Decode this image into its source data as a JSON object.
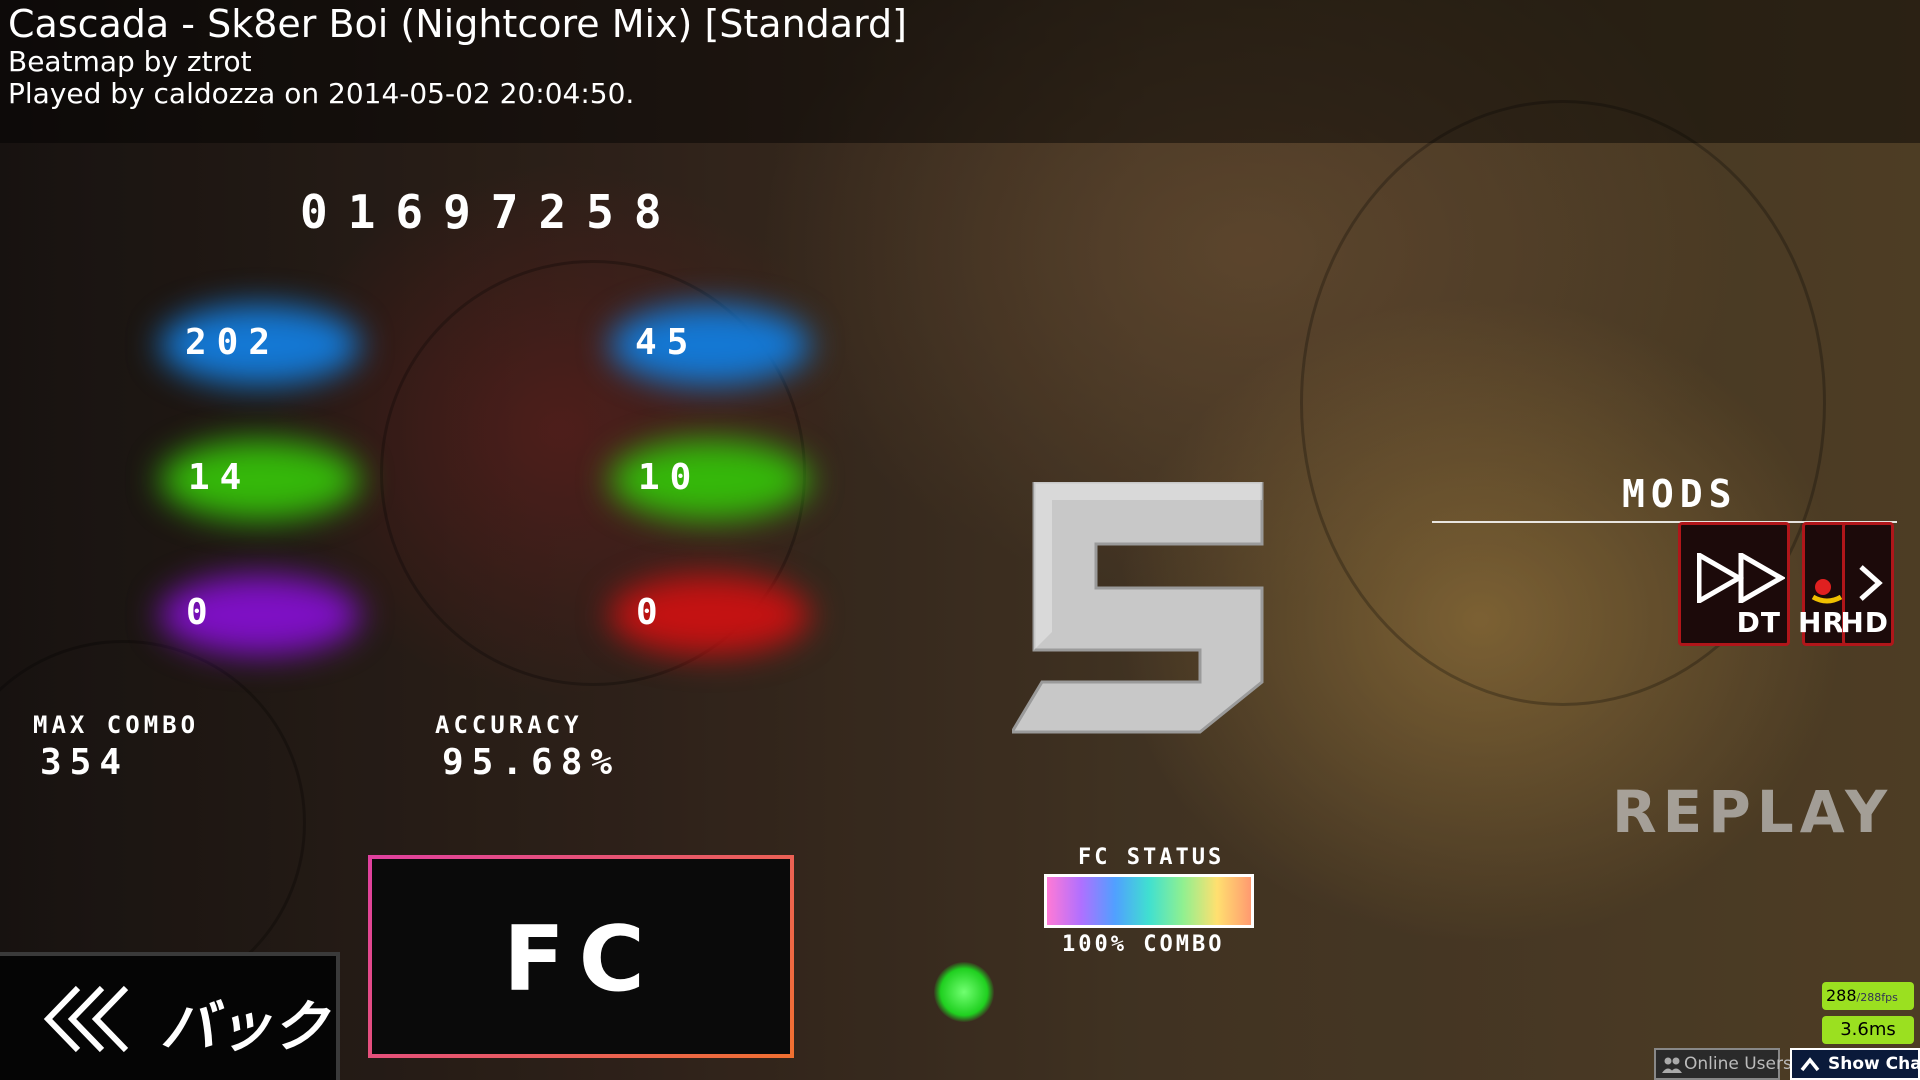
{
  "header": {
    "title": "Cascada - Sk8er Boi (Nightcore Mix) [Standard]",
    "beatmap_by": "Beatmap by ztrot",
    "played_by": "Played by caldozza on 2014-05-02 20:04:50."
  },
  "score": "01697258",
  "hits": {
    "count_300": "202",
    "count_geki": "45",
    "count_100": "14",
    "count_katu": "10",
    "count_50": "0",
    "count_miss": "0"
  },
  "stats": {
    "max_combo_label": "MAX COMBO",
    "max_combo": "354",
    "accuracy_label": "ACCURACY",
    "accuracy": "95.68%"
  },
  "grade": "S",
  "mods": {
    "title": "MODS",
    "items": [
      {
        "label": "DT",
        "icon": "double-time-icon"
      },
      {
        "label": "HR",
        "icon": "hard-rock-icon"
      },
      {
        "label": "HD",
        "icon": "hidden-icon"
      }
    ]
  },
  "replay_label": "REPLAY",
  "fc": {
    "box_label": "FC",
    "status_label": "FC STATUS",
    "combo_label": "100% COMBO"
  },
  "back_button": {
    "label": "バック",
    "icon": "chevrons-left-icon"
  },
  "perf": {
    "fps": "288",
    "fps_limit": "/288fps",
    "frame_time": "3.6ms"
  },
  "bottom_bar": {
    "online_users": "Online Users",
    "show_chat": "Show Chat"
  },
  "colors": {
    "great": "#1478d4",
    "good": "#35b80a",
    "meh": "#7e10c4",
    "miss": "#c41212",
    "mod_border": "#b0161a",
    "perf_badge": "#9be020"
  }
}
